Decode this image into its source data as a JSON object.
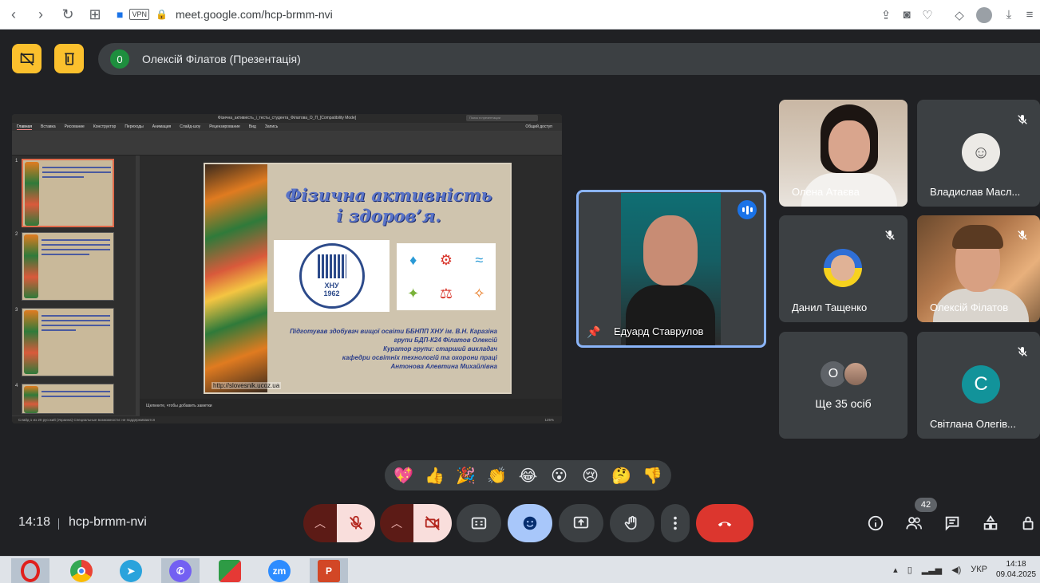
{
  "browser": {
    "url": "meet.google.com/hcp-brmm-nvi",
    "vpn_label": "VPN"
  },
  "presenter_bar": {
    "badge": "0",
    "text": "Олексій Філатов (Презентація)"
  },
  "presentation": {
    "window_title": "Фізична_активність_і_тесты_студента_Філатова_О_П_[Compatibility Mode]",
    "search_placeholder": "Поиск в презентации",
    "tabs": [
      "Главная",
      "Вставка",
      "Рисование",
      "Конструктор",
      "Переходы",
      "Анимация",
      "Слайд-шоу",
      "Рецензирование",
      "Вид",
      "Запись"
    ],
    "share_label": "Общий доступ",
    "thumb_numbers": [
      "1",
      "2",
      "3",
      "4"
    ],
    "slide": {
      "title_line1": "Фізична активність",
      "title_line2": "і здоров’я.",
      "logo_text": "ХНУ",
      "logo_year": "1962",
      "text_lines": [
        "Підготував здобувач вищої освіти ББНПП ХНУ ім. В.Н. Каразіна",
        "групи БДП-К24 Філатов Олексій",
        "Куратор групи: старший викладач",
        "кафедри освітніх технологій та охорони праці",
        "Антонова Алевтина Михайлівна"
      ],
      "url": "http://slovesnik.ucoz.ua"
    },
    "notes_placeholder": "Щелкните, чтобы добавить заметки",
    "status_text": "Слайд 1 из 20   русский (Украина)   Специальные возможности: не поддерживаются",
    "zoom": "125%"
  },
  "speaker": {
    "name": "Едуард Ставрулов"
  },
  "participants": [
    {
      "name": "Олена Атаєва"
    },
    {
      "name": "Владислав Масл..."
    },
    {
      "name": "Данил Тащенко"
    },
    {
      "name": "Олексій Філатов"
    },
    {
      "name": "Ще 35 осіб",
      "avatar_letter": "О"
    },
    {
      "name": "Світлана Олегів...",
      "avatar_letter": "С"
    }
  ],
  "reactions": [
    "💖",
    "👍",
    "🎉",
    "👏",
    "😂",
    "😮",
    "😢",
    "🤔",
    "👎"
  ],
  "footer": {
    "time": "14:18",
    "meeting_code": "hcp-brmm-nvi",
    "people_count": "42"
  },
  "taskbar": {
    "apps": [
      "opera",
      "chrome",
      "telegram",
      "viber",
      "app-5",
      "zoom",
      "powerpoint"
    ],
    "zoom_label": "zm",
    "language": "УКР",
    "clock_time": "14:18",
    "clock_date": "09.04.2025"
  },
  "colors": {
    "meet_bg": "#202124",
    "tile_bg": "#3c4043",
    "accent_yellow": "#fbc02d",
    "active_border": "#8ab4f8",
    "end_call": "#dc362e"
  }
}
